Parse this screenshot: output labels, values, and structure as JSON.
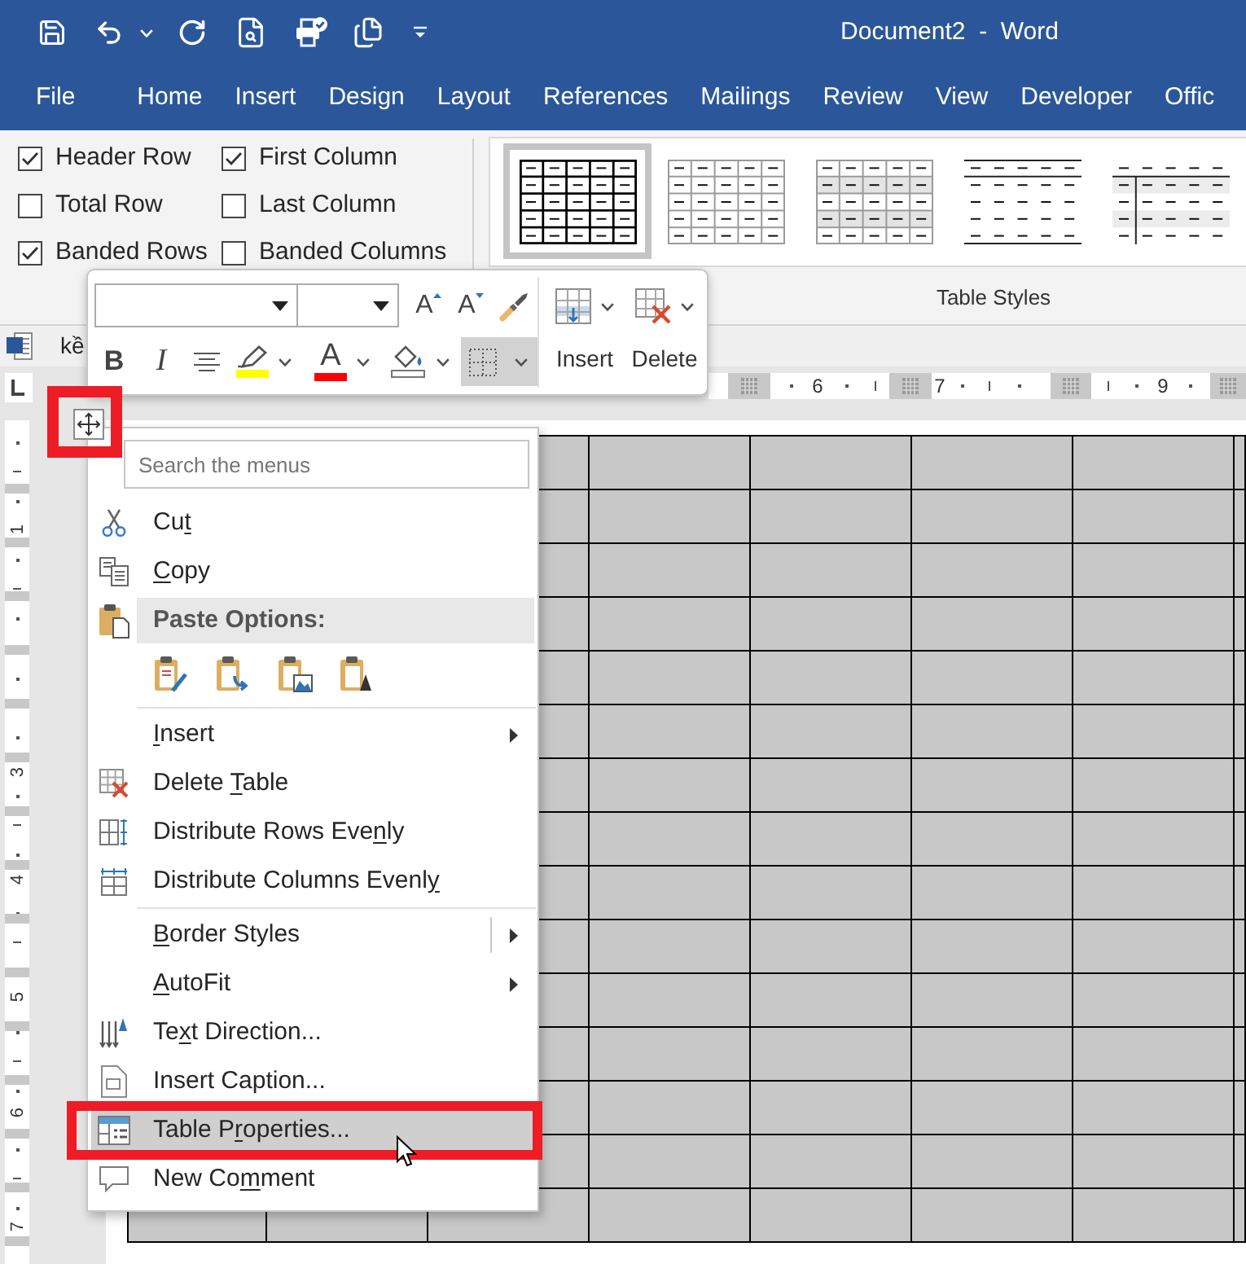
{
  "title_bar": {
    "title": "Document2  -  Word"
  },
  "tabs": [
    {
      "label": "File",
      "selected": false
    },
    {
      "label": "Home",
      "selected": false
    },
    {
      "label": "Insert",
      "selected": false
    },
    {
      "label": "Design",
      "selected": false
    },
    {
      "label": "Layout",
      "selected": false
    },
    {
      "label": "References",
      "selected": false
    },
    {
      "label": "Mailings",
      "selected": false
    },
    {
      "label": "Review",
      "selected": false
    },
    {
      "label": "View",
      "selected": false
    },
    {
      "label": "Developer",
      "selected": false
    },
    {
      "label": "Offic",
      "selected": false
    }
  ],
  "style_options": [
    {
      "label": "Header Row",
      "checked": true
    },
    {
      "label": "Total Row",
      "checked": false
    },
    {
      "label": "Banded Rows",
      "checked": true
    },
    {
      "label": "First Column",
      "checked": true
    },
    {
      "label": "Last Column",
      "checked": false
    },
    {
      "label": "Banded Columns",
      "checked": false
    }
  ],
  "table_styles": {
    "styles": [
      {
        "kind": "grid",
        "selected": true
      },
      {
        "kind": "light",
        "selected": false
      },
      {
        "kind": "shaded",
        "selected": false
      },
      {
        "kind": "lines",
        "selected": false
      },
      {
        "kind": "column",
        "selected": false
      }
    ],
    "label": "Table Styles"
  },
  "document_tab": {
    "title": "kề"
  },
  "horizontal_ruler": {
    "numbers": [
      "6",
      "7",
      "9"
    ]
  },
  "vertical_ruler": {
    "numbers": [
      "1",
      "3",
      "4",
      "5",
      "6",
      "7"
    ]
  },
  "mini_toolbar": {
    "font_buttons": [
      {
        "kind": "grow",
        "label": "A"
      },
      {
        "kind": "shrink",
        "label": "A"
      },
      {
        "kind": "painter"
      }
    ],
    "format_buttons": [
      {
        "kind": "bold",
        "label": "B",
        "pressed": false
      },
      {
        "kind": "italic",
        "label": "I",
        "pressed": false
      },
      {
        "kind": "center",
        "pressed": false
      },
      {
        "kind": "highlight",
        "color": "#ffff00",
        "pressed": false
      },
      {
        "kind": "font_color",
        "label": "A",
        "color": "#ff0000",
        "pressed": false
      },
      {
        "kind": "shading",
        "pressed": false
      },
      {
        "kind": "borders",
        "pressed": true
      }
    ],
    "table_buttons": [
      {
        "kind": "insert",
        "label": "Insert"
      },
      {
        "kind": "delete",
        "label": "Delete"
      }
    ]
  },
  "context_menu": {
    "search": {
      "placeholder": "Search the menus"
    },
    "clipboard_items": [
      {
        "kind": "cut",
        "label_parts": [
          {
            "text": "Cu",
            "underlined": false
          },
          {
            "text": "t",
            "underlined": true
          }
        ],
        "submenu": false,
        "selected": false
      },
      {
        "kind": "copy",
        "label_parts": [
          {
            "text": "C",
            "underlined": true
          },
          {
            "text": "opy",
            "underlined": false
          }
        ],
        "submenu": false,
        "selected": false
      }
    ],
    "paste_options": {
      "label": "Paste Options:",
      "options": [
        {
          "kind": "keep_source"
        },
        {
          "kind": "merge"
        },
        {
          "kind": "picture"
        },
        {
          "kind": "text_only"
        }
      ]
    },
    "table_items": [
      {
        "kind": "insert",
        "label_parts": [
          {
            "text": "I",
            "underlined": true
          },
          {
            "text": "nsert",
            "underlined": false
          }
        ],
        "submenu": true,
        "selected": false
      },
      {
        "kind": "delete_table",
        "label_parts": [
          {
            "text": "Delete ",
            "underlined": false
          },
          {
            "text": "T",
            "underlined": true
          },
          {
            "text": "able",
            "underlined": false
          }
        ],
        "submenu": false,
        "selected": false
      },
      {
        "kind": "distribute_rows",
        "label_parts": [
          {
            "text": "Distribute Rows Eve",
            "underlined": false
          },
          {
            "text": "n",
            "underlined": true
          },
          {
            "text": "ly",
            "underlined": false
          }
        ],
        "submenu": false,
        "selected": false
      },
      {
        "kind": "distribute_columns",
        "label_parts": [
          {
            "text": "Distribute Columns Evenl",
            "underlined": false
          },
          {
            "text": "y",
            "underlined": true
          }
        ],
        "submenu": false,
        "selected": false
      }
    ],
    "format_items": [
      {
        "kind": "border_styles",
        "label_parts": [
          {
            "text": "B",
            "underlined": true
          },
          {
            "text": "order Styles",
            "underlined": false
          }
        ],
        "submenu": true,
        "split": true,
        "selected": false
      },
      {
        "kind": "autofit",
        "label_parts": [
          {
            "text": "A",
            "underlined": true
          },
          {
            "text": "utoFit",
            "underlined": false
          }
        ],
        "submenu": true,
        "selected": false
      },
      {
        "kind": "text_direction",
        "label_parts": [
          {
            "text": "Te",
            "underlined": false
          },
          {
            "text": "x",
            "underlined": true
          },
          {
            "text": "t Direction...",
            "underlined": false
          }
        ],
        "submenu": false,
        "selected": false
      },
      {
        "kind": "insert_caption",
        "label_parts": [
          {
            "text": "Insert Caption...",
            "underlined": false
          }
        ],
        "submenu": false,
        "selected": false
      },
      {
        "kind": "table_properties",
        "label_parts": [
          {
            "text": "Table P",
            "underlined": false
          },
          {
            "text": "r",
            "underlined": true
          },
          {
            "text": "operties...",
            "underlined": false
          }
        ],
        "submenu": false,
        "selected": true
      },
      {
        "kind": "new_comment",
        "label_parts": [
          {
            "text": "New Co",
            "underlined": false
          },
          {
            "text": "m",
            "underlined": true
          },
          {
            "text": "ment",
            "underlined": false
          }
        ],
        "submenu": false,
        "selected": false
      }
    ]
  }
}
